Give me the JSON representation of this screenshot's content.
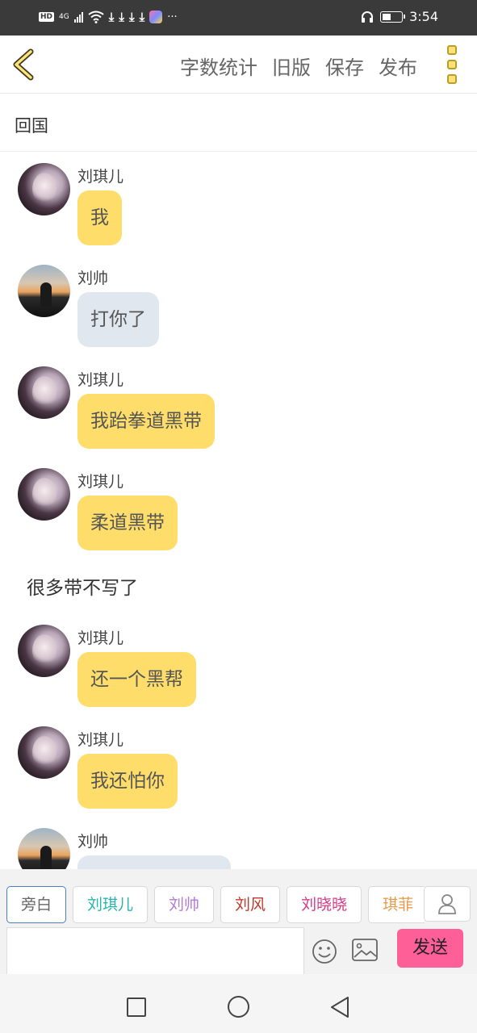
{
  "status_bar": {
    "hd": "HD",
    "network": "4G",
    "time": "3:54",
    "more": "···"
  },
  "toolbar": {
    "actions": [
      "字数统计",
      "旧版",
      "保存",
      "发布"
    ]
  },
  "title": "回国",
  "messages": [
    {
      "type": "chat",
      "speaker": "刘琪儿",
      "avatar": "girl",
      "bubble_color": "#ffdd6b",
      "text": "我"
    },
    {
      "type": "chat",
      "speaker": "刘帅",
      "avatar": "boy",
      "bubble_color": "#e1e7ee",
      "text": "打你了"
    },
    {
      "type": "chat",
      "speaker": "刘琪儿",
      "avatar": "girl",
      "bubble_color": "#ffdd6b",
      "text": "我跆拳道黑带"
    },
    {
      "type": "chat",
      "speaker": "刘琪儿",
      "avatar": "girl",
      "bubble_color": "#ffdd6b",
      "text": "柔道黑带"
    },
    {
      "type": "narration",
      "text": "很多带不写了"
    },
    {
      "type": "chat",
      "speaker": "刘琪儿",
      "avatar": "girl",
      "bubble_color": "#ffdd6b",
      "text": "还一个黑帮"
    },
    {
      "type": "chat",
      "speaker": "刘琪儿",
      "avatar": "girl",
      "bubble_color": "#ffdd6b",
      "text": "我还怕你"
    },
    {
      "type": "chat",
      "speaker": "刘帅",
      "avatar": "boy",
      "bubble_color": "#e1e7ee",
      "text": ""
    }
  ],
  "roles": [
    {
      "label": "旁白",
      "color": "#666666",
      "active": true
    },
    {
      "label": "刘琪儿",
      "color": "#27b6ad"
    },
    {
      "label": "刘帅",
      "color": "#b47ad6"
    },
    {
      "label": "刘风",
      "color": "#c0392b"
    },
    {
      "label": "刘晓晓",
      "color": "#d63a8a"
    },
    {
      "label": "琪菲",
      "color": "#e89a4b"
    }
  ],
  "input": {
    "value": "",
    "send_label": "发送"
  },
  "colors": {
    "accent_yellow": "#ffdd6b",
    "send_pink": "#ff5f97",
    "status_bar": "#3a3a3a"
  }
}
